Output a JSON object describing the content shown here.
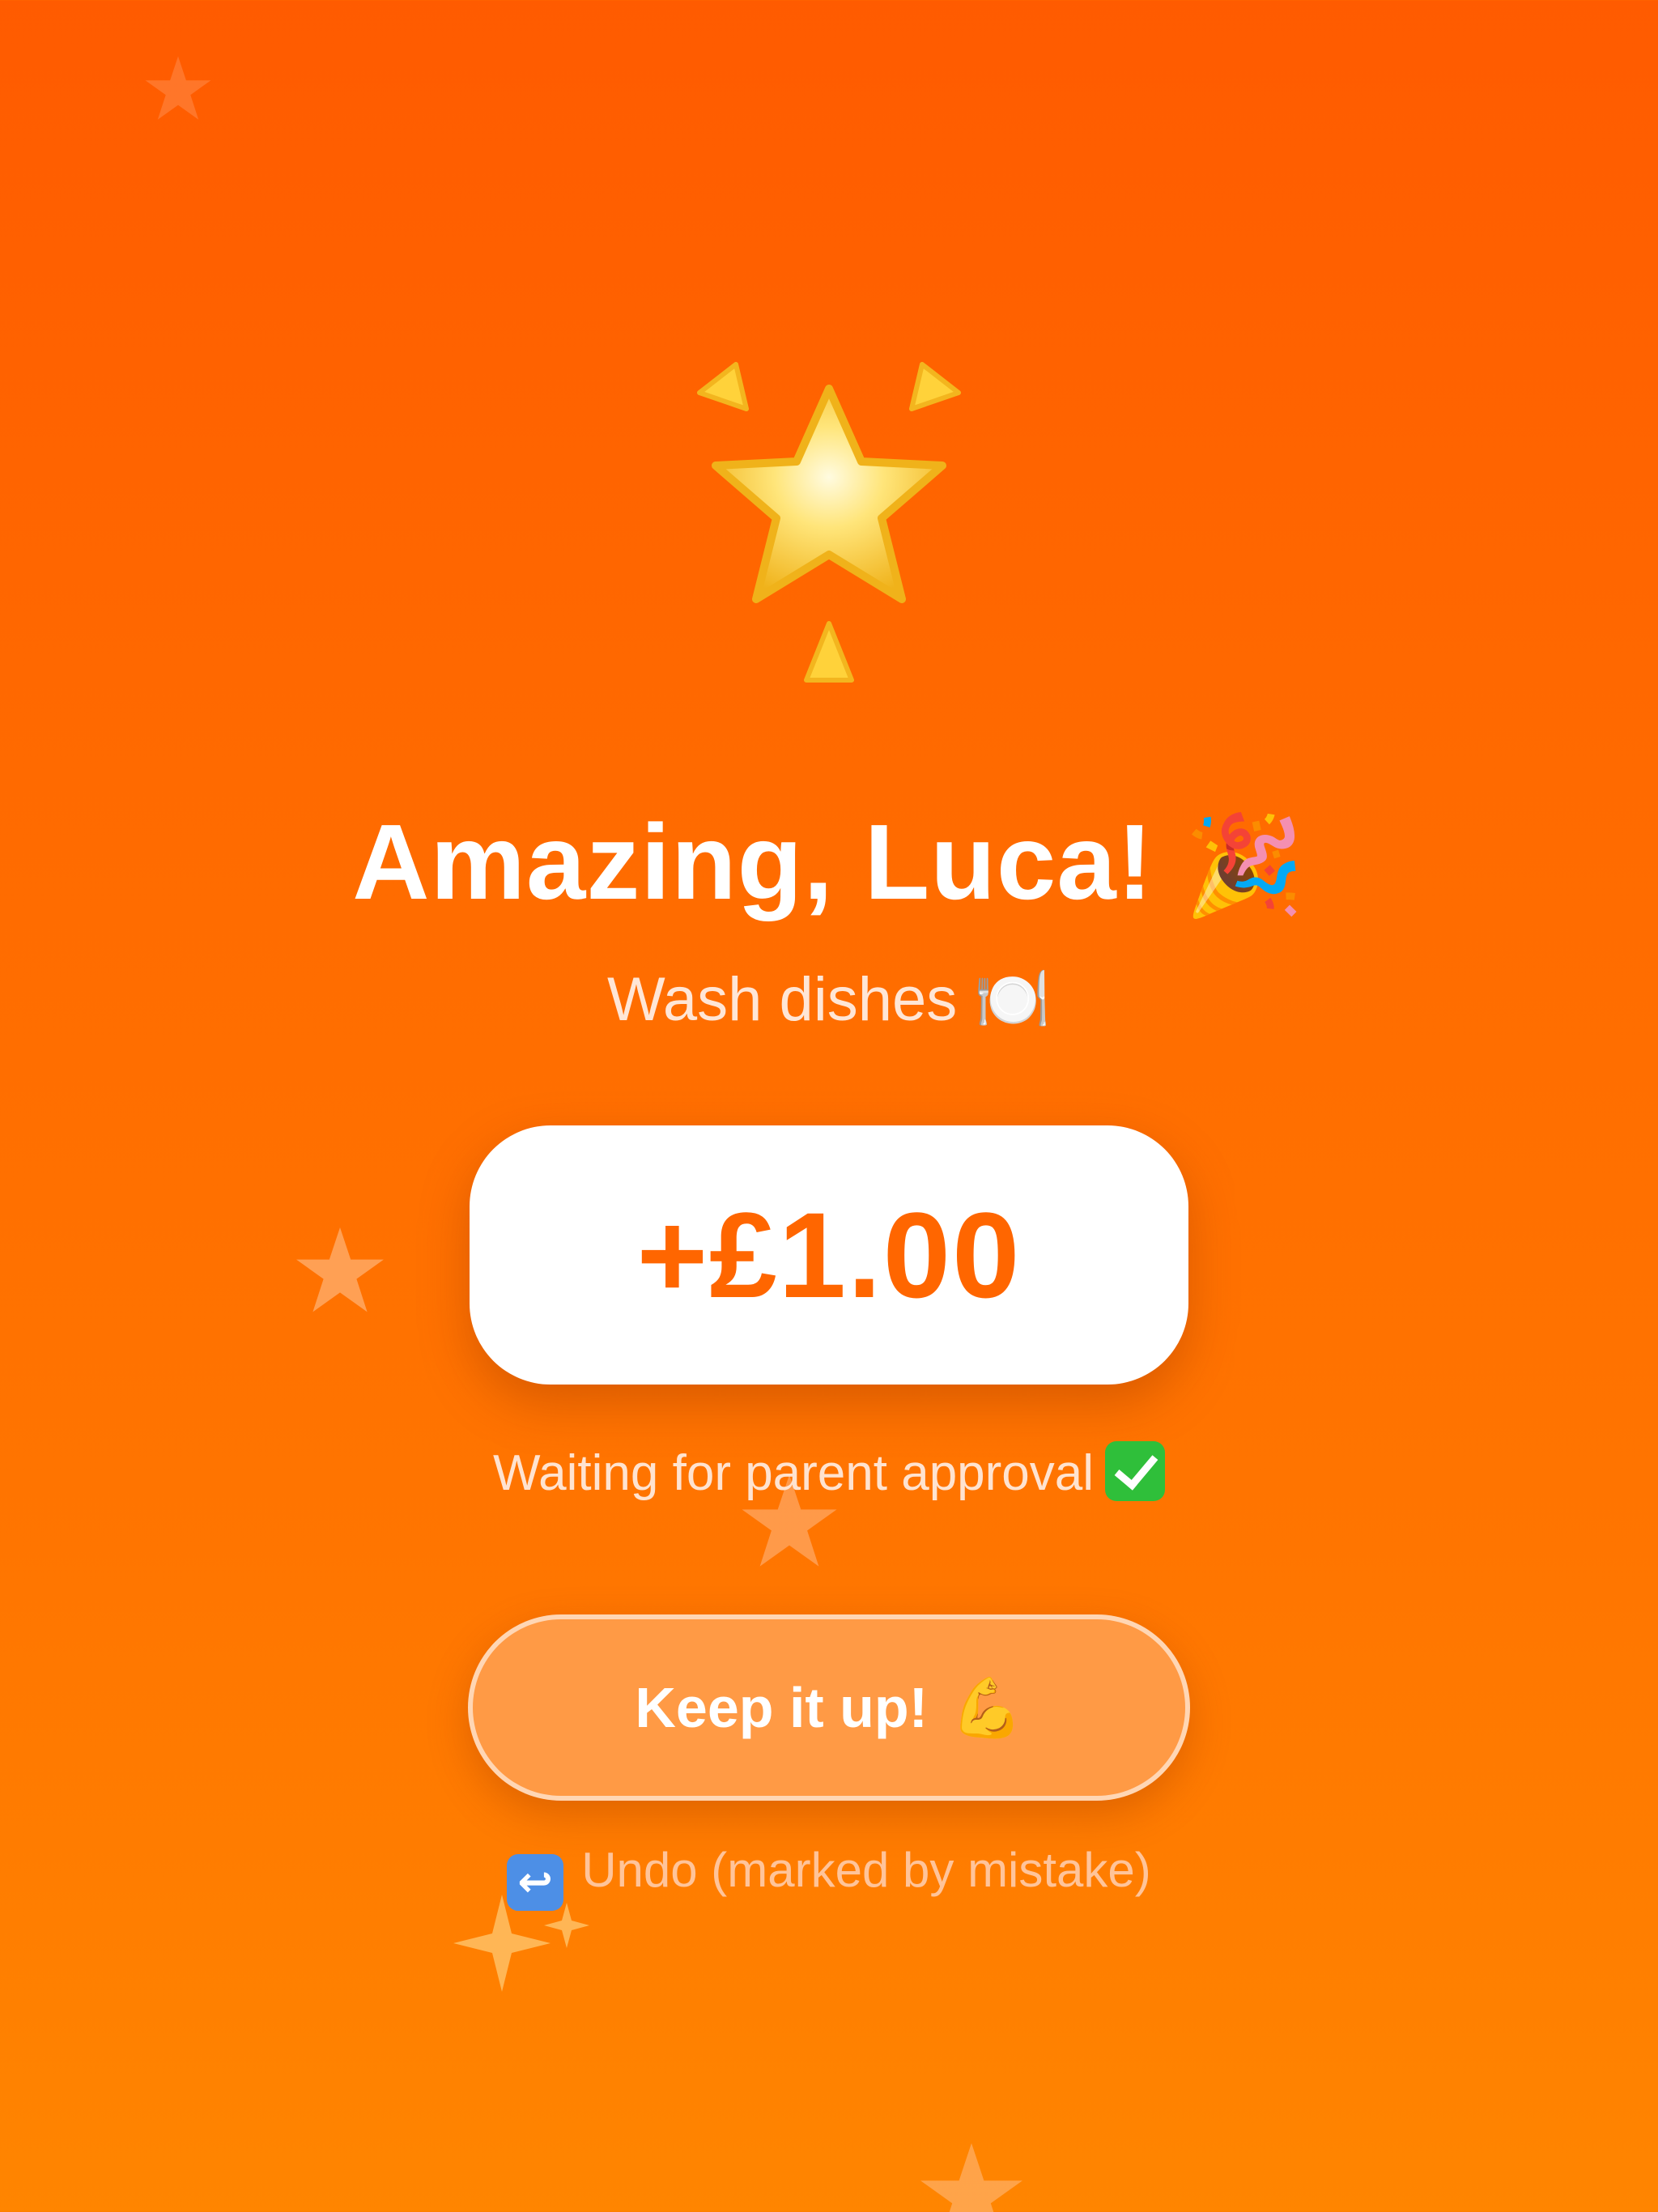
{
  "celebration": {
    "title": "Amazing, Luca!",
    "title_emoji": "🎉",
    "task_name": "Wash dishes",
    "task_emoji": "🍽️",
    "reward_amount": "+£1.00",
    "status_text": "Waiting for parent approval",
    "status_icon": "check-mark-button-icon",
    "primary_action_label": "Keep it up!",
    "primary_action_emoji": "💪",
    "undo_icon_glyph": "↩",
    "undo_label": "Undo (marked by mistake)"
  },
  "colors": {
    "background_top": "#ff5b00",
    "background_bottom": "#ff8500",
    "amount_text": "#ff6600",
    "card_background": "#ffffff",
    "button_background": "#ff9a45",
    "check_green": "#2fbf3a",
    "undo_icon_blue": "#4d8fe6"
  },
  "icons": [
    "glowing-star-icon",
    "party-popper-icon",
    "plate-with-cutlery-icon",
    "check-mark-button-icon",
    "flexed-biceps-icon",
    "return-arrow-icon",
    "sparkle-star-icon"
  ]
}
